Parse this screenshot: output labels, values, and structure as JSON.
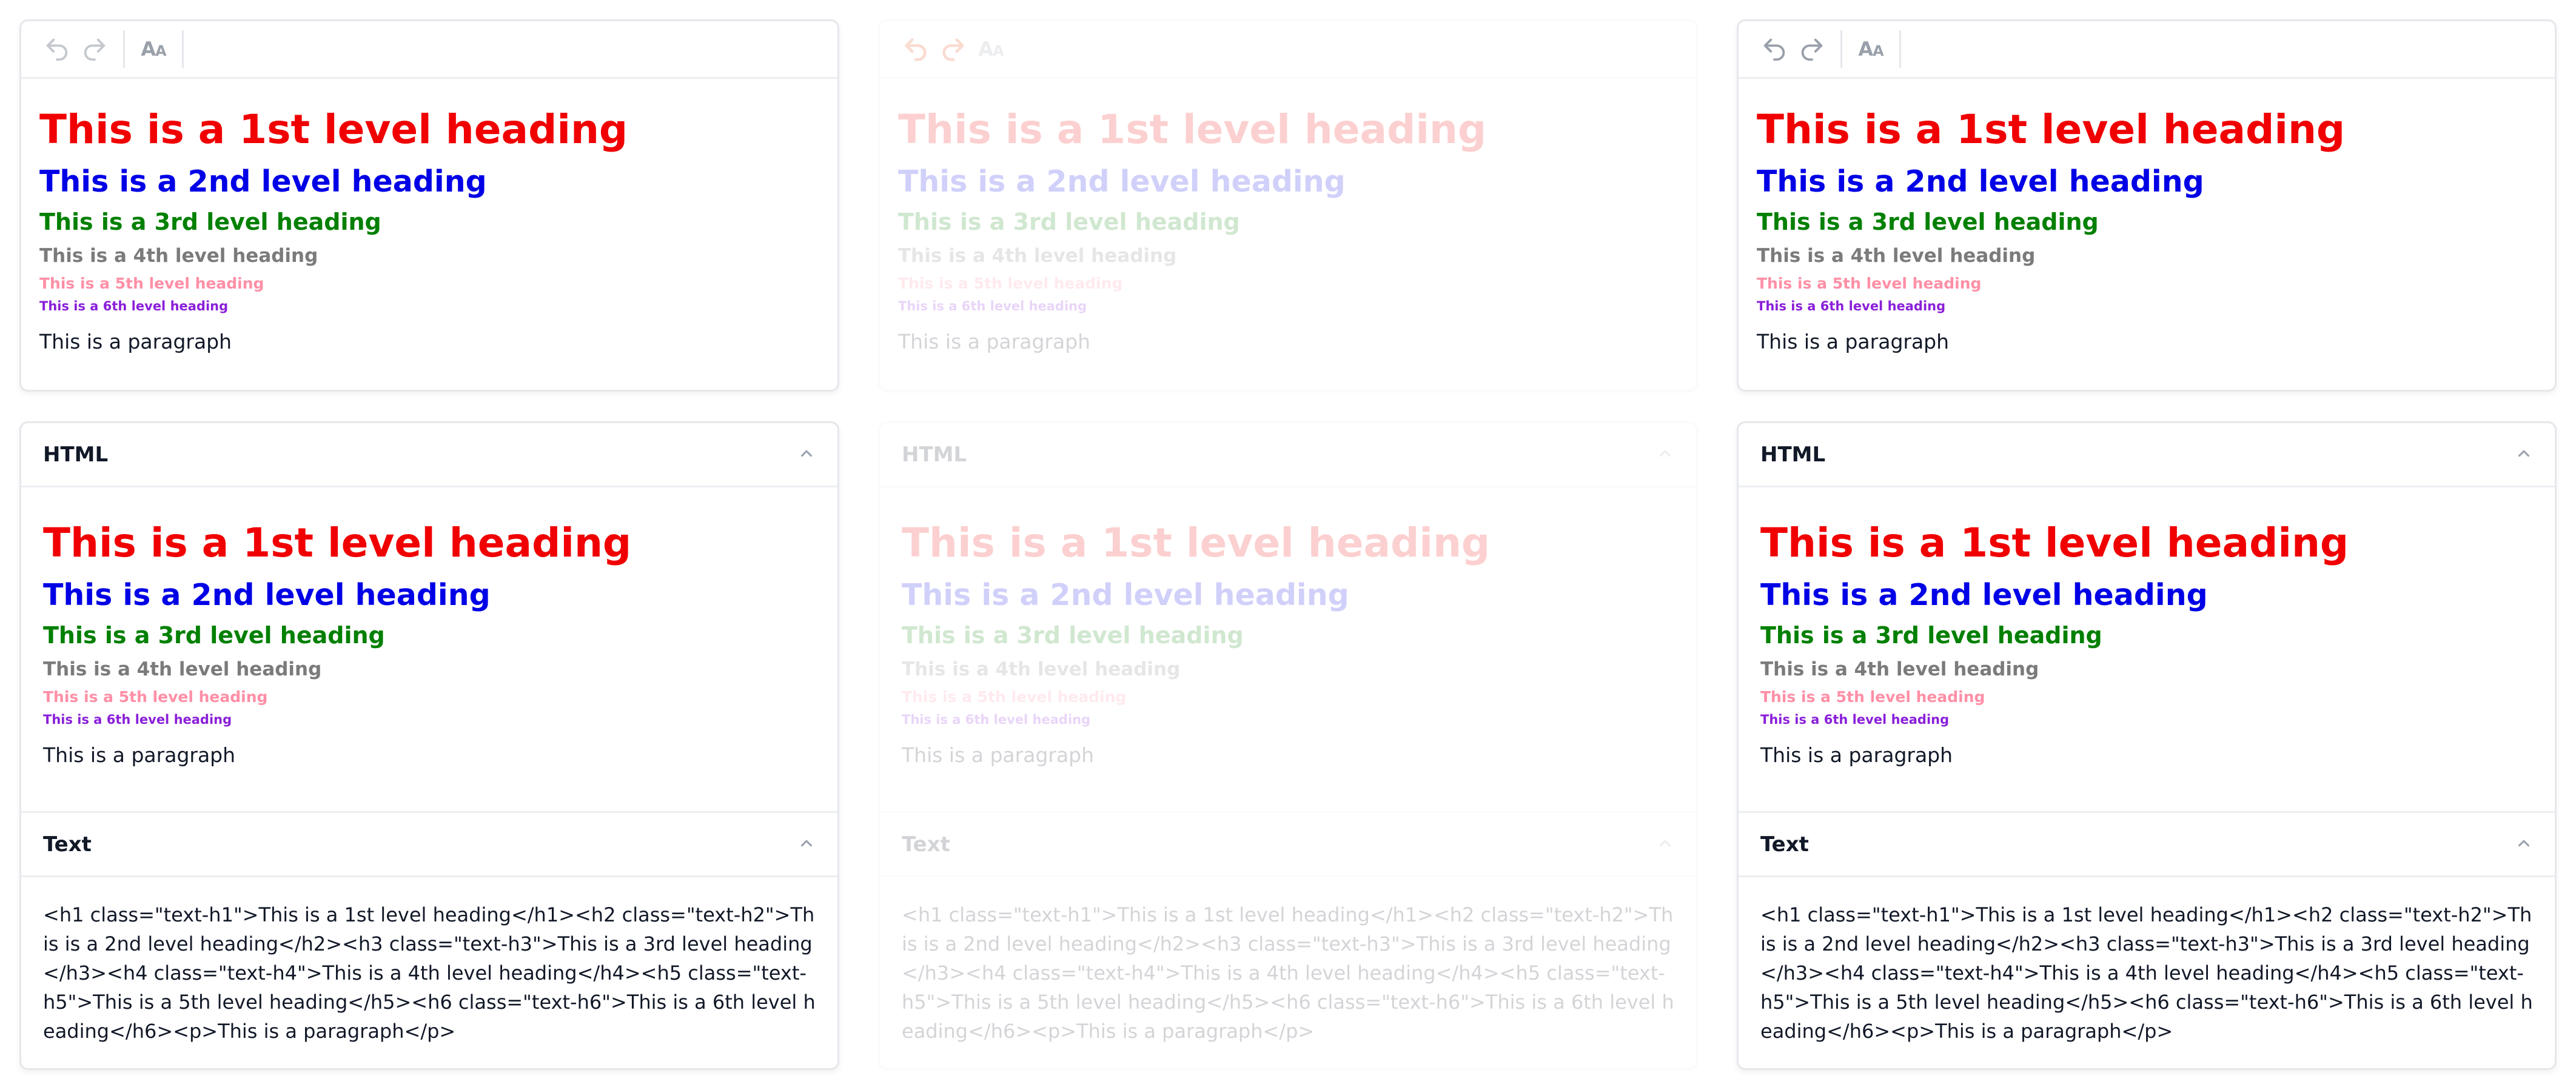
{
  "toolbar": {
    "undo_icon": "undo-icon",
    "redo_icon": "redo-icon",
    "font_size_label_big": "A",
    "font_size_label_small": "A"
  },
  "headings": {
    "h1": "This is a 1st level heading",
    "h2": "This is a 2nd level heading",
    "h3": "This is a 3rd level heading",
    "h4": "This is a 4th level heading",
    "h5": "This is a 5th level heading",
    "h6": "This is a 6th level heading",
    "p": "This is a paragraph"
  },
  "sections": {
    "html_title": "HTML",
    "text_title": "Text"
  },
  "source_text": "<h1 class=\"text-h1\">This is a 1st level heading</h1><h2 class=\"text-h2\">This is a 2nd level heading</h2><h3 class=\"text-h3\">This is a 3rd level heading</h3><h4 class=\"text-h4\">This is a 4th level heading</h4><h5 class=\"text-h5\">This is a 5th level heading</h5><h6 class=\"text-h6\">This is a 6th level heading</h6><p>This is a paragraph</p>",
  "colors": {
    "h1": "#f00000",
    "h2": "#0000e6",
    "h3": "#008000",
    "h4": "#7b7b7b",
    "h5": "#ff8fa6",
    "h6": "#8a1fd9",
    "undo_active": "#e53e00"
  }
}
